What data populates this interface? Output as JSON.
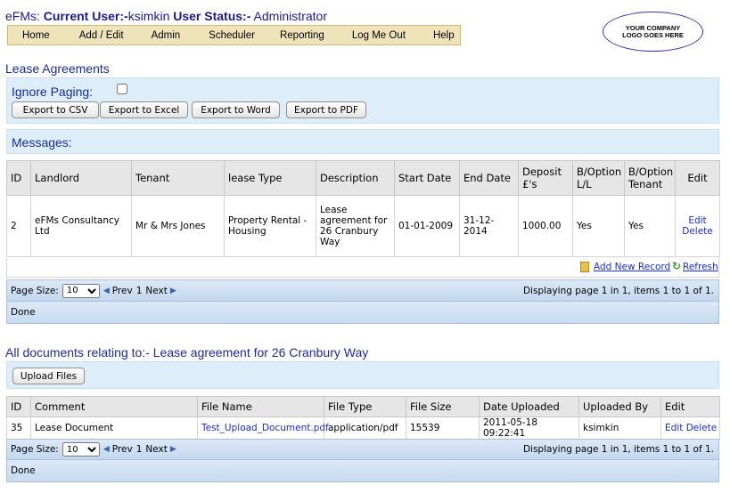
{
  "header": {
    "app_name": "eFMs:",
    "current_user_label": "Current User:-",
    "current_user": "ksimkin",
    "user_status_label": "User Status:-",
    "user_status": "Administrator"
  },
  "nav": [
    "Home",
    "Add / Edit",
    "Admin",
    "Scheduler",
    "Reporting",
    "Log Me Out",
    "Help"
  ],
  "logo": {
    "text": "YOUR COMPANY LOGO GOES HERE"
  },
  "lease_section": {
    "title": "Lease Agreements",
    "ignore_paging_label": "Ignore Paging:",
    "ignore_paging_checked": false,
    "export_buttons": [
      "Export to CSV",
      "Export to Excel",
      "Export to Word",
      "Export to PDF"
    ],
    "messages_label": "Messages:"
  },
  "lease_table": {
    "columns": [
      "ID",
      "Landlord",
      "Tenant",
      "lease Type",
      "Description",
      "Start Date",
      "End Date",
      "Deposit £'s",
      "B/Option L/L",
      "B/Option Tenant",
      "Edit"
    ],
    "rows": [
      {
        "id": "2",
        "landlord": "eFMs Consultancy Ltd",
        "tenant": "Mr & Mrs Jones",
        "lease_type": "Property Rental - Housing",
        "description": "Lease agreement for 26 Cranbury Way",
        "start_date": "01-01-2009",
        "end_date": "31-12-2014",
        "deposit": "1000.00",
        "boption_ll": "Yes",
        "boption_tenant": "Yes",
        "edit": "Edit",
        "delete": "Delete"
      }
    ],
    "add_new_record": "Add New Record",
    "refresh": "Refresh"
  },
  "lease_pager": {
    "page_size_label": "Page Size:",
    "page_size": "10",
    "prev_label": "Prev",
    "page_number": "1",
    "next_label": "Next",
    "status": "Displaying page 1 in 1, items 1 to 1 of 1.",
    "done": "Done"
  },
  "documents_section": {
    "title": "All documents relating to:- Lease agreement for 26 Cranbury Way",
    "upload_button": "Upload Files"
  },
  "documents_table": {
    "columns": [
      "ID",
      "Comment",
      "File Name",
      "File Type",
      "File Size",
      "Date Uploaded",
      "Uploaded By",
      "Edit"
    ],
    "rows": [
      {
        "id": "35",
        "comment": "Lease Document",
        "file_name": "Test_Upload_Document.pdf",
        "file_type": "application/pdf",
        "file_size": "15539",
        "date_uploaded": "2011-05-18 09:22:41",
        "uploaded_by": "ksimkin",
        "edit": "Edit",
        "delete": "Delete"
      }
    ]
  },
  "documents_pager": {
    "page_size_label": "Page Size:",
    "page_size": "10",
    "prev_label": "Prev",
    "page_number": "1",
    "next_label": "Next",
    "status": "Displaying page 1 in 1, items 1 to 1 of 1.",
    "done": "Done"
  }
}
